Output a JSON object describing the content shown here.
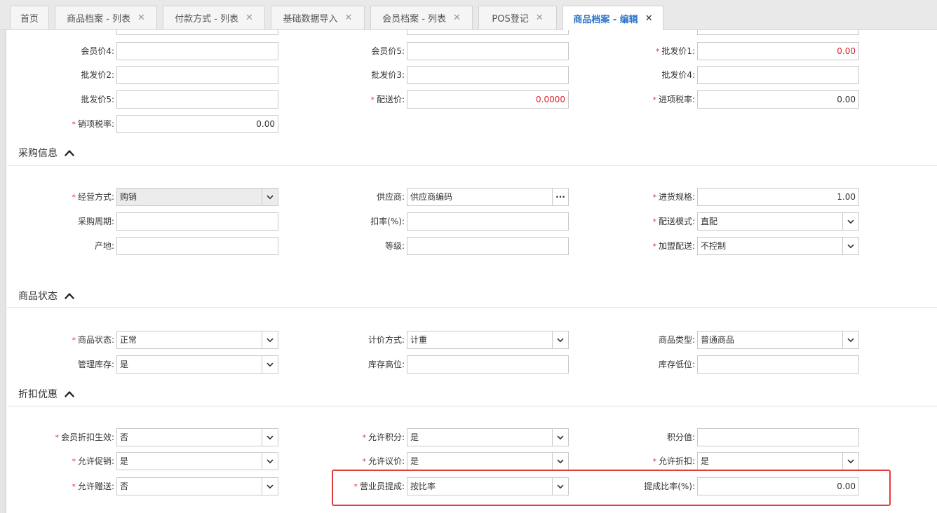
{
  "tabs": [
    {
      "label": "首页",
      "closable": false,
      "active": false
    },
    {
      "label": "商品档案 - 列表",
      "closable": true,
      "active": false
    },
    {
      "label": "付款方式 - 列表",
      "closable": true,
      "active": false
    },
    {
      "label": "基础数据导入",
      "closable": true,
      "active": false
    },
    {
      "label": "会员档案 - 列表",
      "closable": true,
      "active": false
    },
    {
      "label": "POS登记",
      "closable": true,
      "active": false
    },
    {
      "label": "商品档案 - 编辑",
      "closable": true,
      "active": true
    }
  ],
  "close_glyph": "✕",
  "required_mark": "*",
  "price": {
    "member_price_4": {
      "label": "会员价4:",
      "value": ""
    },
    "member_price_5": {
      "label": "会员价5:",
      "value": ""
    },
    "wholesale_price_1": {
      "label": "批发价1:",
      "value": "0.00"
    },
    "wholesale_price_2": {
      "label": "批发价2:",
      "value": ""
    },
    "wholesale_price_3": {
      "label": "批发价3:",
      "value": ""
    },
    "wholesale_price_4": {
      "label": "批发价4:",
      "value": ""
    },
    "wholesale_price_5": {
      "label": "批发价5:",
      "value": ""
    },
    "delivery_price": {
      "label": "配送价:",
      "value": "0.0000"
    },
    "input_tax_rate": {
      "label": "进项税率:",
      "value": "0.00"
    },
    "output_tax_rate": {
      "label": "销项税率:",
      "value": "0.00"
    }
  },
  "purchase": {
    "title": "采购信息",
    "business_mode": {
      "label": "经营方式:",
      "value": "购销"
    },
    "supplier": {
      "label": "供应商:",
      "value": "供应商编码",
      "button": "···"
    },
    "purchase_spec": {
      "label": "进货规格:",
      "value": "1.00"
    },
    "purchase_cycle": {
      "label": "采购周期:",
      "value": ""
    },
    "discount_rate": {
      "label": "扣率(%):",
      "value": ""
    },
    "delivery_mode": {
      "label": "配送模式:",
      "value": "直配"
    },
    "origin": {
      "label": "产地:",
      "value": ""
    },
    "grade": {
      "label": "等级:",
      "value": ""
    },
    "franchise_delivery": {
      "label": "加盟配送:",
      "value": "不控制"
    }
  },
  "status": {
    "title": "商品状态",
    "product_status": {
      "label": "商品状态:",
      "value": "正常"
    },
    "pricing_method": {
      "label": "计价方式:",
      "value": "计重"
    },
    "product_type": {
      "label": "商品类型:",
      "value": "普通商品"
    },
    "manage_stock": {
      "label": "管理库存:",
      "value": "是"
    },
    "stock_high": {
      "label": "库存高位:",
      "value": ""
    },
    "stock_low": {
      "label": "库存低位:",
      "value": ""
    }
  },
  "discount": {
    "title": "折扣优惠",
    "member_discount": {
      "label": "会员折扣生效:",
      "value": "否"
    },
    "allow_points": {
      "label": "允许积分:",
      "value": "是"
    },
    "points_value": {
      "label": "积分值:",
      "value": ""
    },
    "allow_promotion": {
      "label": "允许促销:",
      "value": "是"
    },
    "allow_bargain": {
      "label": "允许议价:",
      "value": "是"
    },
    "allow_discount": {
      "label": "允许折扣:",
      "value": "是"
    },
    "allow_gift": {
      "label": "允许赠送:",
      "value": "否"
    },
    "sales_commission": {
      "label": "营业员提成:",
      "value": "按比率"
    },
    "commission_rate": {
      "label": "提成比率(%):",
      "value": "0.00"
    }
  },
  "colors": {
    "accent": "#2a74c8",
    "required": "#e33b3b",
    "value_red": "#d9232d",
    "highlight": "#e23d3d"
  }
}
